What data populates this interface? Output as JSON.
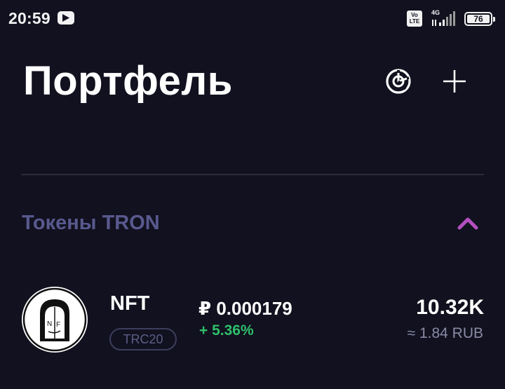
{
  "status_bar": {
    "time": "20:59",
    "network": "4G",
    "volte": "Vo\nLTE",
    "battery": "76"
  },
  "header": {
    "title": "Портфель",
    "chart_icon": "pie-chart-icon",
    "add_icon": "plus-icon"
  },
  "section": {
    "title": "Токены TRON",
    "toggle_icon": "chevron-up-icon",
    "toggle_color": "#b44fc0"
  },
  "tokens": [
    {
      "name": "NFT",
      "standard": "TRC20",
      "price": "₽ 0.000179",
      "change": "+ 5.36%",
      "change_color": "#2fbf6a",
      "amount": "10.32K",
      "fiat_value": "≈ 1.84 RUB",
      "icon": "nft-avatar-icon"
    }
  ]
}
